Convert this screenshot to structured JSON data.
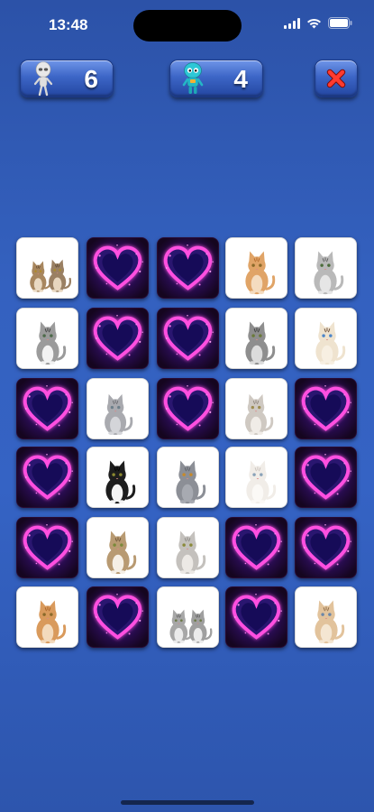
{
  "status_bar": {
    "time": "13:48"
  },
  "players": [
    {
      "name": "player-1",
      "score": "6",
      "avatar_icon": "grey-alien-icon"
    },
    {
      "name": "player-2",
      "score": "4",
      "avatar_icon": "teal-robot-icon"
    }
  ],
  "close_icon": "red-x-icon",
  "colors": {
    "background": "#3461bf",
    "card_face": "#ffffff",
    "card_back": "#2a0c3e",
    "heart": "#e03ad8"
  },
  "board": {
    "rows": 6,
    "cols": 5,
    "cards": [
      [
        "two-kittens",
        "heart-back",
        "heart-back",
        "ginger-kitten",
        "grey-tabby-cat"
      ],
      [
        "tabby-kitten",
        "heart-back",
        "heart-back",
        "grey-kitten",
        "siamese-cat"
      ],
      [
        "heart-back",
        "grey-cat-sitting",
        "heart-back",
        "white-grey-cat",
        "heart-back"
      ],
      [
        "heart-back",
        "tuxedo-cat",
        "grey-shorthair-cat",
        "white-cat",
        "heart-back"
      ],
      [
        "heart-back",
        "tabby-white-kitten",
        "silver-longhair-cat",
        "heart-back",
        "heart-back"
      ],
      [
        "orange-kitten",
        "heart-back",
        "two-grey-kittens",
        "heart-back",
        "cream-cat"
      ]
    ]
  }
}
